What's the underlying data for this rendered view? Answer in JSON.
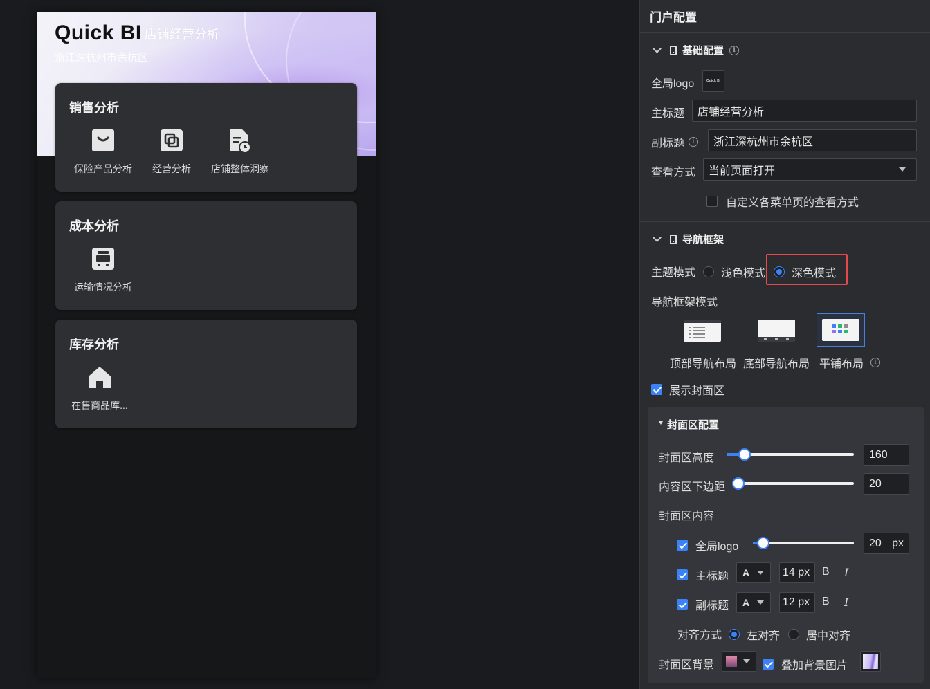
{
  "preview": {
    "logo_text": "Quick BI",
    "title": "店铺经营分析",
    "subtitle": "浙江深杭州市余杭区",
    "groups": [
      {
        "title": "销售分析",
        "items": [
          {
            "label": "保险产品分析",
            "icon": "shopping-bag-icon"
          },
          {
            "label": "经营分析",
            "icon": "copy-icon"
          },
          {
            "label": "店铺整体洞察",
            "icon": "document-clock-icon"
          }
        ]
      },
      {
        "title": "成本分析",
        "items": [
          {
            "label": "运输情况分析",
            "icon": "bus-icon"
          }
        ]
      },
      {
        "title": "库存分析",
        "items": [
          {
            "label": "在售商品库...",
            "icon": "home-icon"
          }
        ]
      }
    ]
  },
  "panel": {
    "title": "门户配置",
    "basic": {
      "section_title": "基础配置",
      "logo_label": "全局logo",
      "main_title_label": "主标题",
      "main_title_value": "店铺经营分析",
      "subtitle_label": "副标题",
      "subtitle_value": "浙江深杭州市余杭区",
      "view_mode_label": "查看方式",
      "view_mode_value": "当前页面打开",
      "custom_view_label": "自定义各菜单页的查看方式"
    },
    "nav": {
      "section_title": "导航框架",
      "theme_label": "主题模式",
      "theme_light": "浅色模式",
      "theme_dark": "深色模式",
      "frame_mode_label": "导航框架模式",
      "layout_top": "顶部导航布局",
      "layout_bottom": "底部导航布局",
      "layout_tile": "平铺布局",
      "show_cover_label": "展示封面区"
    },
    "cover": {
      "section_title": "封面区配置",
      "height_label": "封面区高度",
      "height_value": "160",
      "margin_label": "内容区下边距",
      "margin_value": "20",
      "content_label": "封面区内容",
      "logo_label": "全局logo",
      "logo_size": "20",
      "logo_unit": "px",
      "main_title_label": "主标题",
      "main_title_font": "A",
      "main_title_size": "14 px",
      "subtitle_label": "副标题",
      "subtitle_font": "A",
      "subtitle_size": "12 px",
      "bold": "B",
      "italic": "I",
      "align_label": "对齐方式",
      "align_left": "左对齐",
      "align_center": "居中对齐",
      "bg_label": "封面区背景",
      "overlay_label": "叠加背景图片"
    }
  },
  "colors": {
    "accent": "#3b82f6",
    "highlight_border": "#e5484d",
    "panel_bg": "#2b2c30",
    "card_bg": "#2e2f33"
  }
}
